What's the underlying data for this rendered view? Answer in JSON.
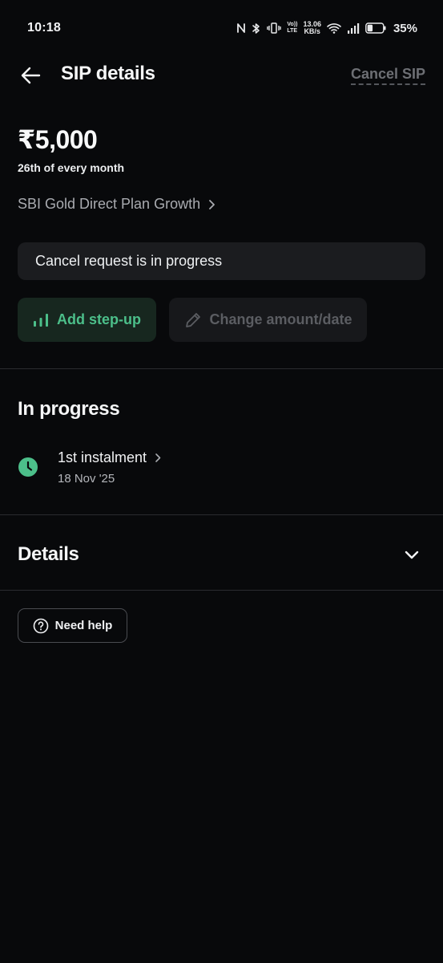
{
  "status_bar": {
    "time": "10:18",
    "net_speed_value": "13.06",
    "net_speed_unit": "KB/s",
    "volte_top": "Vo))",
    "volte_bottom": "LTE",
    "battery_percent": "35%",
    "icons": [
      "nfc-icon",
      "bluetooth-icon",
      "vibrate-icon",
      "volte-icon",
      "wifi-icon",
      "signal-icon",
      "battery-icon"
    ],
    "battery_level": 0.35
  },
  "header": {
    "title": "SIP details",
    "cancel_label": "Cancel SIP"
  },
  "sip": {
    "amount": "₹5,000",
    "schedule": "26th of every month",
    "fund_name": "SBI Gold Direct Plan Growth",
    "cancel_status": "Cancel request is in progress"
  },
  "actions": {
    "stepup_label": "Add step-up",
    "change_label": "Change amount/date"
  },
  "in_progress": {
    "title": "In progress",
    "items": [
      {
        "title": "1st instalment",
        "date": "18 Nov '25"
      }
    ]
  },
  "details": {
    "title": "Details"
  },
  "help": {
    "label": "Need help"
  },
  "colors": {
    "background": "#08090b",
    "accent_green": "#4cbf8a",
    "stepup_bg": "#17271f",
    "card_bg": "#1b1c1f",
    "muted_text": "#a9abb0"
  }
}
